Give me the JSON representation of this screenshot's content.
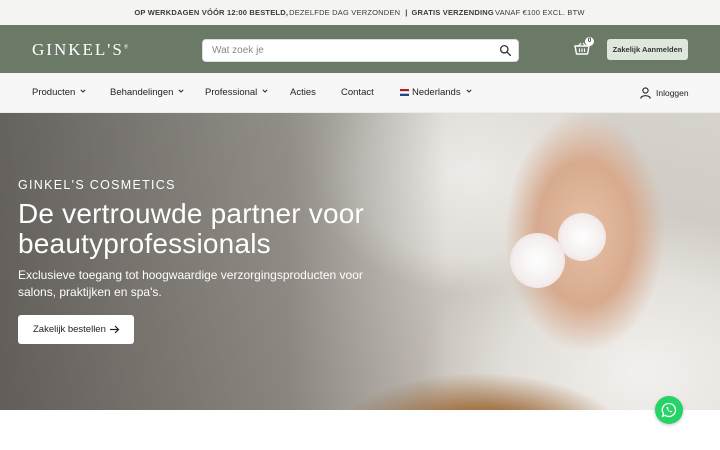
{
  "topbar": {
    "part1": "OP WERKDAGEN VÓÓR 12:00 BESTELD,",
    "part2": "DEZELFDE DAG VERZONDEN",
    "sep": "|",
    "part3": "GRATIS VERZENDING",
    "part4": "VANAF €100 EXCL. BTW"
  },
  "header": {
    "logo": "GINKEL'S",
    "logo_mark": "®",
    "search_placeholder": "Wat zoek je",
    "cart_count": "0",
    "business_login_label": "Zakelijk Aanmelden"
  },
  "nav": {
    "items": [
      {
        "label": "Producten",
        "has_dropdown": true
      },
      {
        "label": "Behandelingen",
        "has_dropdown": true
      },
      {
        "label": "Professional",
        "has_dropdown": true
      },
      {
        "label": "Acties",
        "has_dropdown": false
      },
      {
        "label": "Contact",
        "has_dropdown": false
      }
    ],
    "language": "Nederlands",
    "login": "Inloggen"
  },
  "hero": {
    "eyebrow": "GINKEL'S COSMETICS",
    "title": "De vertrouwde partner voor beautyprofessionals",
    "subtitle": "Exclusieve toegang tot hoogwaardige verzorgingsproducten voor salons, praktijken en spa's.",
    "cta_label": "Zakelijk bestellen"
  },
  "colors": {
    "header_bg": "#6b7a67",
    "business_button_bg": "#dfe6dc",
    "whatsapp": "#25d366"
  },
  "icons": [
    "search-icon",
    "cart-icon",
    "chevron-down-icon",
    "netherlands-flag-icon",
    "user-icon",
    "arrow-right-icon",
    "whatsapp-icon"
  ]
}
